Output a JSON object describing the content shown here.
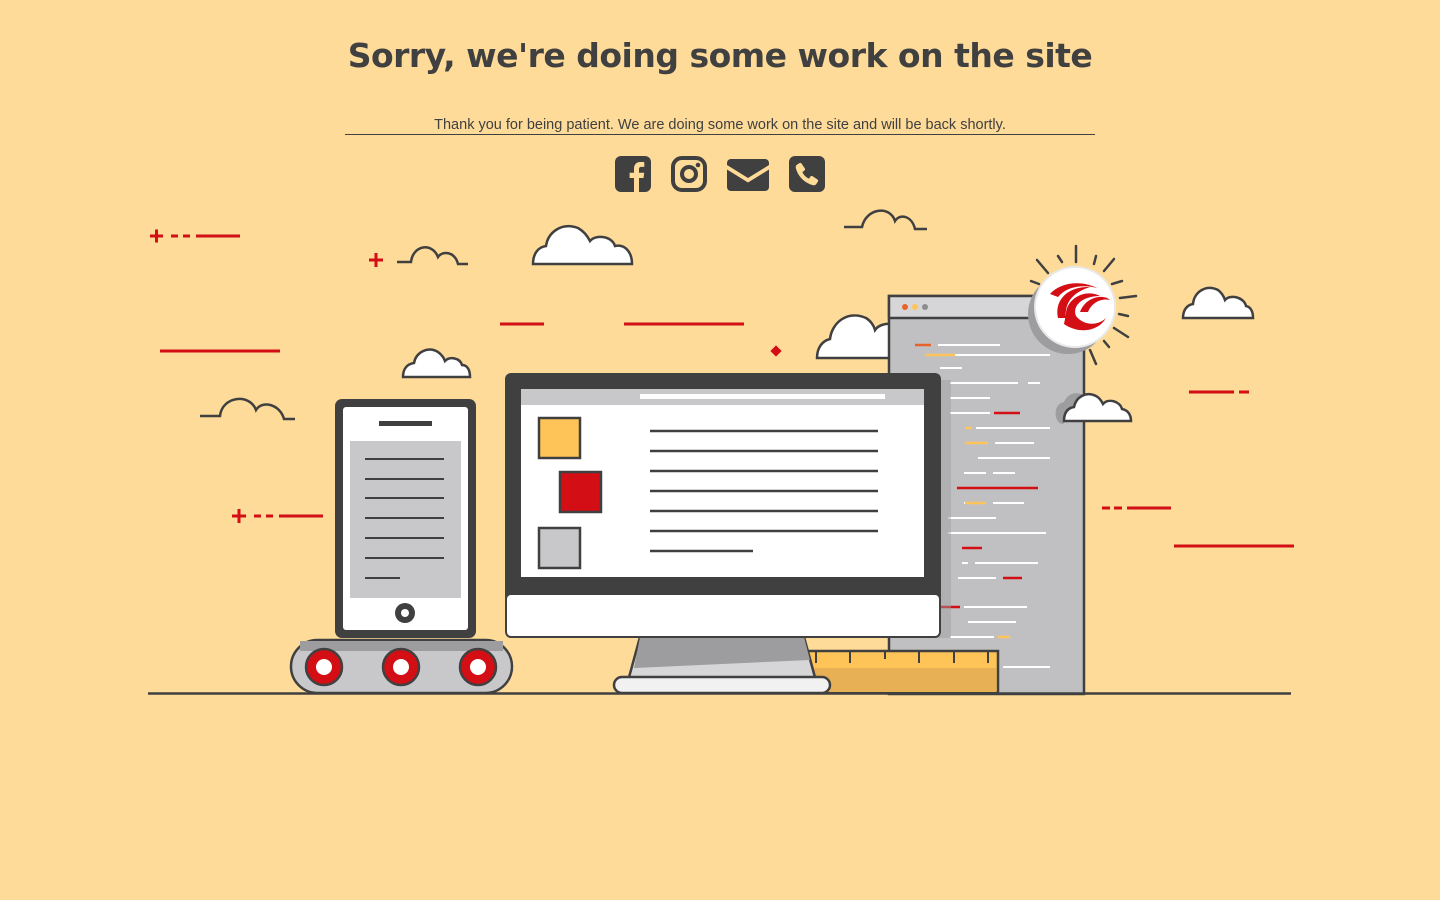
{
  "page": {
    "title": "Sorry, we're doing some work on the site",
    "subtitle": "Thank you for being patient. We are doing some work on the site and will be back shortly."
  },
  "social_links": [
    {
      "icon": "facebook-icon"
    },
    {
      "icon": "instagram-icon"
    },
    {
      "icon": "envelope-icon"
    },
    {
      "icon": "phone-icon"
    }
  ],
  "colors": {
    "background": "#fedb99",
    "text": "#404040",
    "accent_red": "#d30e15",
    "accent_yellow": "#fec458",
    "screen_grey": "#c8c8ca"
  }
}
